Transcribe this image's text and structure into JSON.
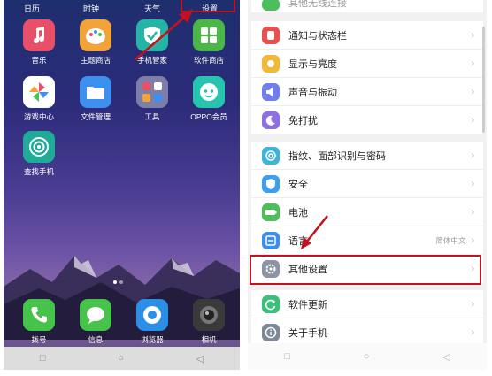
{
  "left_screen": {
    "top_labels": [
      "日历",
      "时钟",
      "天气",
      "设置"
    ],
    "apps": [
      {
        "label": "音乐",
        "icon": "music-note-icon",
        "color": "#e8506a"
      },
      {
        "label": "主题商店",
        "icon": "palette-icon",
        "color": "#f2a33a"
      },
      {
        "label": "手机管家",
        "icon": "shield-check-icon",
        "color": "#25b5a6"
      },
      {
        "label": "软件商店",
        "icon": "app-grid-icon",
        "color": "#4cb749"
      },
      {
        "label": "游戏中心",
        "icon": "pinwheel-icon",
        "color": "#ffffff"
      },
      {
        "label": "文件管理",
        "icon": "folder-icon",
        "color": "#3d8ff0"
      },
      {
        "label": "工具",
        "icon": "tools-folder-icon",
        "color": "#7d7fa8"
      },
      {
        "label": "OPPO会员",
        "icon": "robot-face-icon",
        "color": "#27c4b0"
      },
      {
        "label": "查找手机",
        "icon": "radar-icon",
        "color": "#1faa9a"
      }
    ],
    "dock": [
      {
        "label": "拨号",
        "icon": "phone-icon",
        "color": "#45c34a"
      },
      {
        "label": "信息",
        "icon": "message-bubble-icon",
        "color": "#45c34a"
      },
      {
        "label": "浏览器",
        "icon": "browser-icon",
        "color": "#2b8fe8"
      },
      {
        "label": "相机",
        "icon": "camera-icon",
        "color": "#3a3a3a"
      }
    ],
    "nav": [
      "□",
      "○",
      "◁"
    ]
  },
  "right_screen": {
    "partial_top_label": "其他无线连接",
    "groups": [
      [
        {
          "label": "通知与状态栏",
          "icon": "notification-icon",
          "color": "#e8504f",
          "value": ""
        },
        {
          "label": "显示与亮度",
          "icon": "display-icon",
          "color": "#f2b83a",
          "value": ""
        },
        {
          "label": "声音与振动",
          "icon": "sound-icon",
          "color": "#6f7ee8",
          "value": ""
        },
        {
          "label": "免打扰",
          "icon": "moon-icon",
          "color": "#8e6fe0",
          "value": ""
        }
      ],
      [
        {
          "label": "指纹、面部识别与密码",
          "icon": "fingerprint-icon",
          "color": "#3fb4d8",
          "value": ""
        },
        {
          "label": "安全",
          "icon": "security-shield-icon",
          "color": "#3b9ef0",
          "value": ""
        },
        {
          "label": "电池",
          "icon": "battery-icon",
          "color": "#4cbf5a",
          "value": ""
        },
        {
          "label": "语言",
          "icon": "language-icon",
          "color": "#3e8ee8",
          "value": "简体中文"
        },
        {
          "label": "其他设置",
          "icon": "gear-icon",
          "color": "#8b95a6",
          "value": ""
        }
      ],
      [
        {
          "label": "软件更新",
          "icon": "update-icon",
          "color": "#3cbf7a",
          "value": ""
        },
        {
          "label": "关于手机",
          "icon": "info-icon",
          "color": "#7f8896",
          "value": ""
        }
      ]
    ],
    "chevron": "›",
    "nav": [
      "□",
      "○",
      "◁"
    ]
  },
  "accent": "#c1121f"
}
